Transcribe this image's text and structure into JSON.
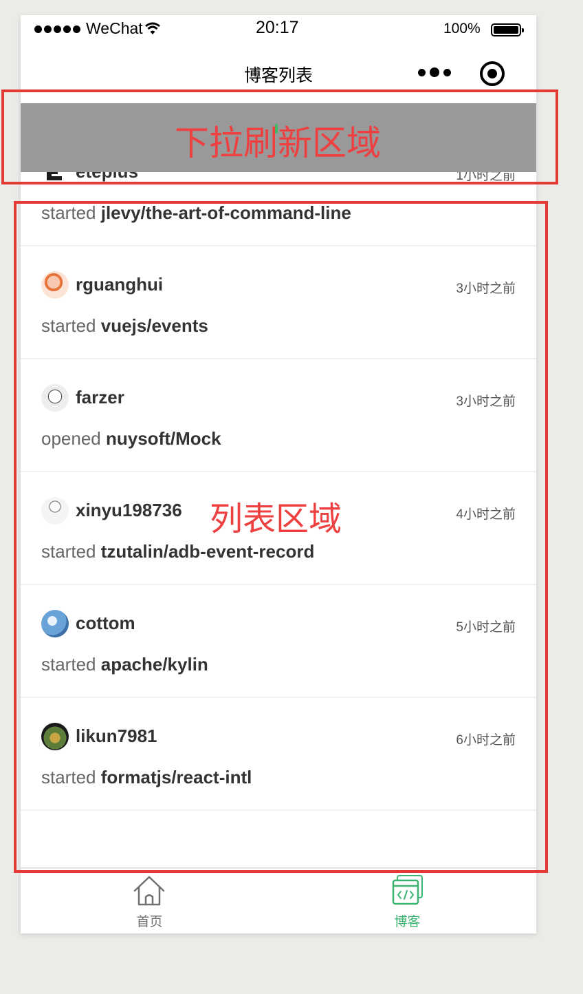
{
  "status_bar": {
    "carrier": "WeChat",
    "time": "20:17",
    "battery": "100%"
  },
  "nav": {
    "title": "博客列表"
  },
  "feed": [
    {
      "user": "eteplus",
      "time": "1小时之前",
      "verb": "started",
      "repo": "jlevy/the-art-of-command-line"
    },
    {
      "user": "rguanghui",
      "time": "3小时之前",
      "verb": "started",
      "repo": "vuejs/events"
    },
    {
      "user": "farzer",
      "time": "3小时之前",
      "verb": "opened",
      "repo": "nuysoft/Mock"
    },
    {
      "user": "xinyu198736",
      "time": "4小时之前",
      "verb": "started",
      "repo": "tzutalin/adb-event-record"
    },
    {
      "user": "cottom",
      "time": "5小时之前",
      "verb": "started",
      "repo": "apache/kylin"
    },
    {
      "user": "likun7981",
      "time": "6小时之前",
      "verb": "started",
      "repo": "formatjs/react-intl"
    }
  ],
  "tabbar": {
    "items": [
      {
        "label": "首页",
        "icon": "home-icon",
        "active": false
      },
      {
        "label": "博客",
        "icon": "code-window-icon",
        "active": true
      }
    ],
    "active_color": "#3cb371",
    "inactive_color": "#707070"
  },
  "annotations": {
    "refresh_label": "下拉刷新区域",
    "list_label": "列表区域",
    "color": "#e53935"
  }
}
